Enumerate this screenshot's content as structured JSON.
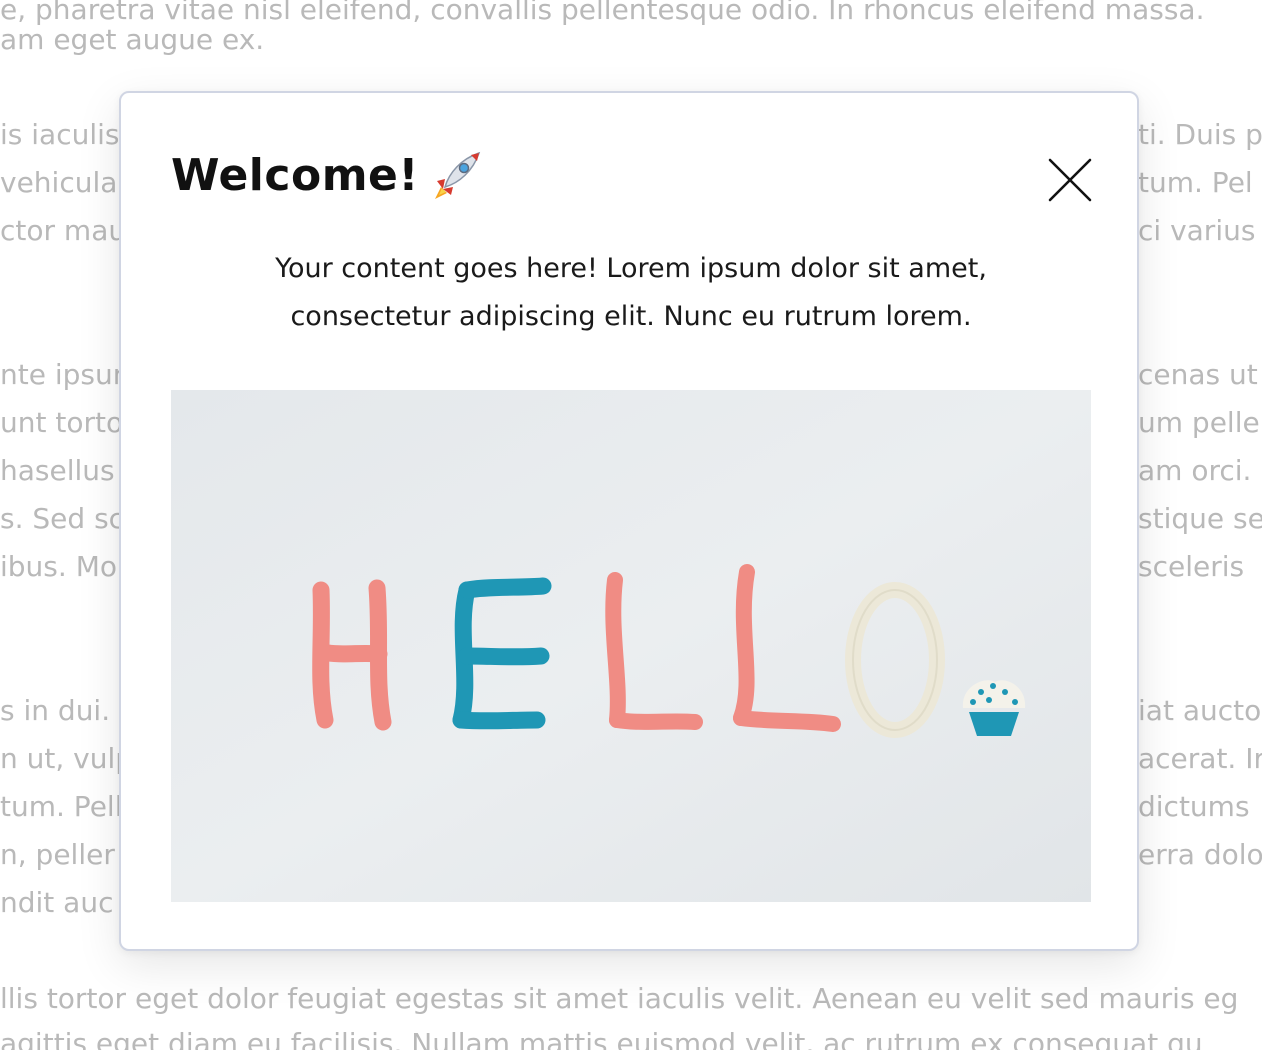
{
  "background": {
    "top_lines": [
      "e, pharetra vitae nisl eleifend, convallis pellentesque odio. In rhoncus eleifend massa.",
      "am eget augue ex."
    ],
    "left_fragments": [
      "is iaculis",
      "vehicula",
      "ctor mau",
      "nte ipsum",
      "unt torto",
      "hasellus",
      "s. Sed sc",
      "ibus. Mo",
      "s in dui.",
      "n ut, vulp",
      "tum. Pell",
      "n, peller",
      "ndit auc"
    ],
    "right_fragments": [
      "ti. Duis p",
      "tum. Pel",
      "ci varius",
      "cenas ut",
      "um peller",
      "am orci.",
      "stique se",
      "sceleris",
      "iat aucto",
      "acerat. Ir",
      "dictums",
      "erra dolo",
      ""
    ],
    "bottom_lines": [
      "llis tortor eget dolor feugiat egestas sit amet iaculis velit. Aenean eu velit sed mauris eg",
      "agittis eget diam eu facilisis. Nullam mattis euismod velit, ac rutrum ex consequat qu"
    ]
  },
  "modal": {
    "title": "Welcome!",
    "title_icon": "rocket-icon",
    "close_icon": "close-icon",
    "body_line_1": "Your content goes here! Lorem ipsum dolor sit amet,",
    "body_line_2": "consectetur adipiscing elit. Nunc eu rutrum lorem.",
    "image_caption_letters": [
      "H",
      "E",
      "L",
      "L",
      "O"
    ],
    "image_subject": "hello-clay-letters-image"
  },
  "colors": {
    "modal_border": "#d0d5e3",
    "title_text": "#111111",
    "background_text": "#b9b9b9",
    "clay_pink": "#f08c84",
    "clay_blue": "#1f97b5",
    "clay_cream": "#ece8d8"
  }
}
